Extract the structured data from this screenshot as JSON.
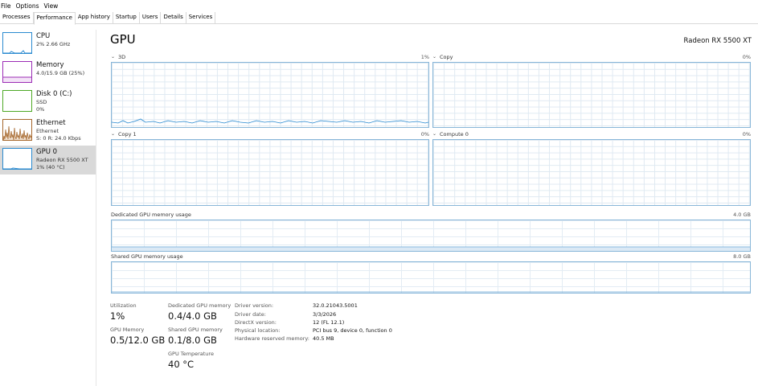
{
  "menu": [
    "File",
    "Options",
    "View"
  ],
  "tabs": [
    "Processes",
    "Performance",
    "App history",
    "Startup",
    "Users",
    "Details",
    "Services"
  ],
  "active_tab": "Performance",
  "sidebar": {
    "items": [
      {
        "name": "CPU",
        "sub1": "2% 2.66 GHz",
        "sub2": "",
        "sub3": "",
        "color": "#2a8ad0"
      },
      {
        "name": "Memory",
        "sub1": "4.0/15.9 GB (25%)",
        "sub2": "",
        "sub3": "",
        "color": "#9b2cb5"
      },
      {
        "name": "Disk 0 (C:)",
        "sub1": "SSD",
        "sub2": "0%",
        "sub3": "",
        "color": "#4da825"
      },
      {
        "name": "Ethernet",
        "sub1": "Ethernet",
        "sub2": "S: 0 R: 24.0 Kbps",
        "sub3": "",
        "color": "#a5662b"
      },
      {
        "name": "GPU 0",
        "sub1": "Radeon RX 5500 XT",
        "sub2": "1% (40 °C)",
        "sub3": "",
        "color": "#2a8ad0"
      }
    ]
  },
  "main": {
    "title": "GPU",
    "model": "Radeon RX 5500 XT",
    "graphs": [
      {
        "label": "3D",
        "pct": "1%"
      },
      {
        "label": "Copy",
        "pct": "0%"
      },
      {
        "label": "Copy 1",
        "pct": "0%"
      },
      {
        "label": "Compute 0",
        "pct": "0%"
      }
    ],
    "dedicated_label": "Dedicated GPU memory usage",
    "dedicated_max": "4.0 GB",
    "shared_label": "Shared GPU memory usage",
    "shared_max": "8.0 GB"
  },
  "stats": {
    "utilization_label": "Utilization",
    "utilization_value": "1%",
    "dedicated_label": "Dedicated GPU memory",
    "dedicated_value": "0.4/4.0 GB",
    "gpu_memory_label": "GPU Memory",
    "gpu_memory_value": "0.5/12.0 GB",
    "shared_label": "Shared GPU memory",
    "shared_value": "0.1/8.0 GB",
    "temp_label": "GPU Temperature",
    "temp_value": "40 °C"
  },
  "info": [
    {
      "key": "Driver version:",
      "value": "32.0.21043.5001"
    },
    {
      "key": "Driver date:",
      "value": "3/3/2026"
    },
    {
      "key": "DirectX version:",
      "value": "12 (FL 12.1)"
    },
    {
      "key": "Physical location:",
      "value": "PCI bus 9, device 0, function 0"
    },
    {
      "key": "Hardware reserved memory:",
      "value": "40.5 MB"
    }
  ]
}
